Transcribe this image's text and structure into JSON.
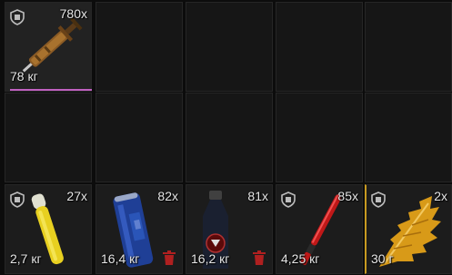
{
  "slots": [
    {
      "qty": "780x",
      "weight": "78 кг",
      "item_icon": "syringe-icon",
      "locked": true,
      "deletable": false,
      "accent": "#c060c0"
    },
    {
      "qty": "27x",
      "weight": "2,7 кг",
      "item_icon": "yellow-tube-icon",
      "locked": true,
      "deletable": false
    },
    {
      "qty": "82x",
      "weight": "16,4 кг",
      "item_icon": "blue-can-icon",
      "locked": false,
      "deletable": true
    },
    {
      "qty": "81x",
      "weight": "16,2 кг",
      "item_icon": "dark-bottle-icon",
      "locked": false,
      "deletable": true
    },
    {
      "qty": "85x",
      "weight": "4,25 кг",
      "item_icon": "red-stick-icon",
      "locked": true,
      "deletable": false
    },
    {
      "qty": "2x",
      "weight": "30 г",
      "item_icon": "orange-leaf-icon",
      "locked": true,
      "deletable": false,
      "accent": "#c89a20"
    }
  ],
  "colors": {
    "background": "#0c0c0c",
    "cell": "#1c1c1c",
    "text": "#e6e6e6",
    "trash": "#b02020"
  }
}
